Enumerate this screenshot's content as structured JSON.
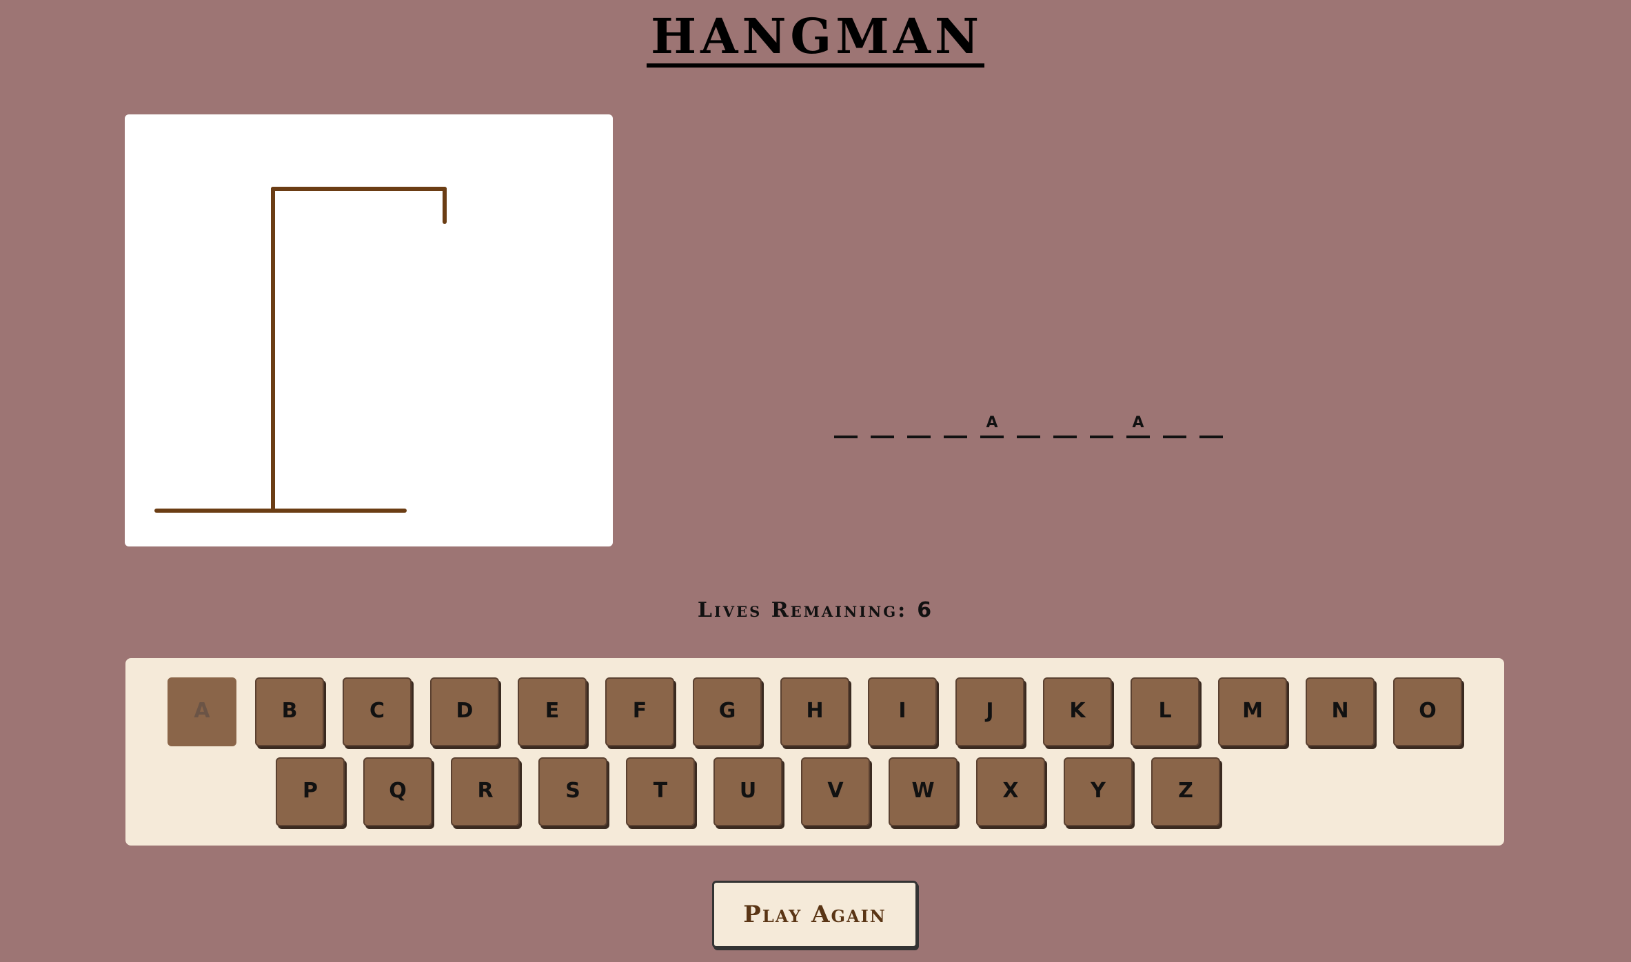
{
  "title": "HANGMAN",
  "word": {
    "slots": [
      "",
      "",
      "",
      "",
      "A",
      "",
      "",
      "",
      "A",
      "",
      ""
    ]
  },
  "lives": {
    "label": "Lives Remaining:",
    "count": "6"
  },
  "keyboard": {
    "row1": [
      "A",
      "B",
      "C",
      "D",
      "E",
      "F",
      "G",
      "H",
      "I",
      "J",
      "K",
      "L",
      "M",
      "N",
      "O"
    ],
    "row2": [
      "P",
      "Q",
      "R",
      "S",
      "T",
      "U",
      "V",
      "W",
      "X",
      "Y",
      "Z"
    ],
    "used": [
      "A"
    ]
  },
  "play_again_label": "Play Again",
  "colors": {
    "background": "#9d7574",
    "gallows": "#6b3d14",
    "key": "#8a6549",
    "panel": "#f5ead9"
  }
}
